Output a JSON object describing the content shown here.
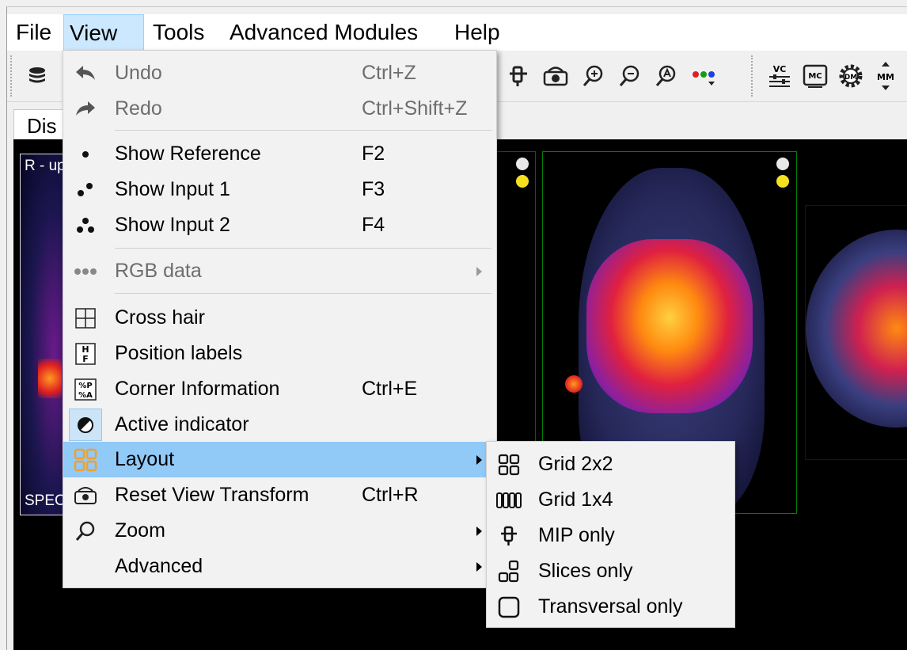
{
  "menubar": {
    "items": [
      {
        "label": "File"
      },
      {
        "label": "View"
      },
      {
        "label": "Tools"
      },
      {
        "label": "Advanced Modules"
      },
      {
        "label": "Help"
      }
    ]
  },
  "toolbar": {
    "badges": {
      "vc": "VC",
      "mc": "MC",
      "dm": "DM",
      "mm": "MM"
    }
  },
  "tabs": {
    "display_label": "Dis"
  },
  "viewer": {
    "panel1_corner_top": "R - up",
    "panel1_corner_bottom": "SPEC"
  },
  "view_menu": {
    "items": [
      {
        "label": "Undo",
        "shortcut": "Ctrl+Z",
        "icon": "undo-icon",
        "enabled": false
      },
      {
        "label": "Redo",
        "shortcut": "Ctrl+Shift+Z",
        "icon": "redo-icon",
        "enabled": false
      },
      {
        "label": "Show Reference",
        "shortcut": "F2",
        "icon": "one-dot-icon",
        "enabled": true
      },
      {
        "label": "Show Input 1",
        "shortcut": "F3",
        "icon": "two-dots-icon",
        "enabled": true
      },
      {
        "label": "Show Input 2",
        "shortcut": "F4",
        "icon": "three-dots-icon",
        "enabled": true
      },
      {
        "label": "RGB data",
        "shortcut": "",
        "icon": "rgb-dots-icon",
        "enabled": false,
        "submenu": true
      },
      {
        "label": "Cross hair",
        "shortcut": "",
        "icon": "crosshair-icon",
        "enabled": true
      },
      {
        "label": "Position labels",
        "shortcut": "",
        "icon": "position-labels-icon",
        "enabled": true
      },
      {
        "label": "Corner Information",
        "shortcut": "Ctrl+E",
        "icon": "corner-info-icon",
        "enabled": true
      },
      {
        "label": "Active indicator",
        "shortcut": "",
        "icon": "active-indicator-icon",
        "enabled": true,
        "checked": true
      },
      {
        "label": "Layout",
        "shortcut": "",
        "icon": "layout-grid-icon",
        "enabled": true,
        "submenu": true,
        "highlighted": true
      },
      {
        "label": "Reset View Transform",
        "shortcut": "Ctrl+R",
        "icon": "reset-view-icon",
        "enabled": true
      },
      {
        "label": "Zoom",
        "shortcut": "",
        "icon": "zoom-icon",
        "enabled": true,
        "submenu": true
      },
      {
        "label": "Advanced",
        "shortcut": "",
        "icon": "",
        "enabled": true,
        "submenu": true
      }
    ],
    "position_labels_icon_text": {
      "top": "H",
      "bottom": "F"
    },
    "corner_info_icon_text": {
      "top": "%P",
      "bottom": "%A"
    }
  },
  "layout_submenu": {
    "items": [
      {
        "label": "Grid 2x2",
        "icon": "grid-2x2-icon"
      },
      {
        "label": "Grid 1x4",
        "icon": "grid-1x4-icon"
      },
      {
        "label": "MIP only",
        "icon": "mip-icon"
      },
      {
        "label": "Slices only",
        "icon": "slices-icon"
      },
      {
        "label": "Transversal only",
        "icon": "transversal-icon"
      }
    ]
  },
  "colors": {
    "menu_highlight": "#91c9f7",
    "menubar_active": "#cce8ff",
    "layout_icon": "#f0a030",
    "panel_red_border": "#c00000",
    "panel_green_border": "#008000",
    "panel_blue_border": "#0000c0"
  }
}
